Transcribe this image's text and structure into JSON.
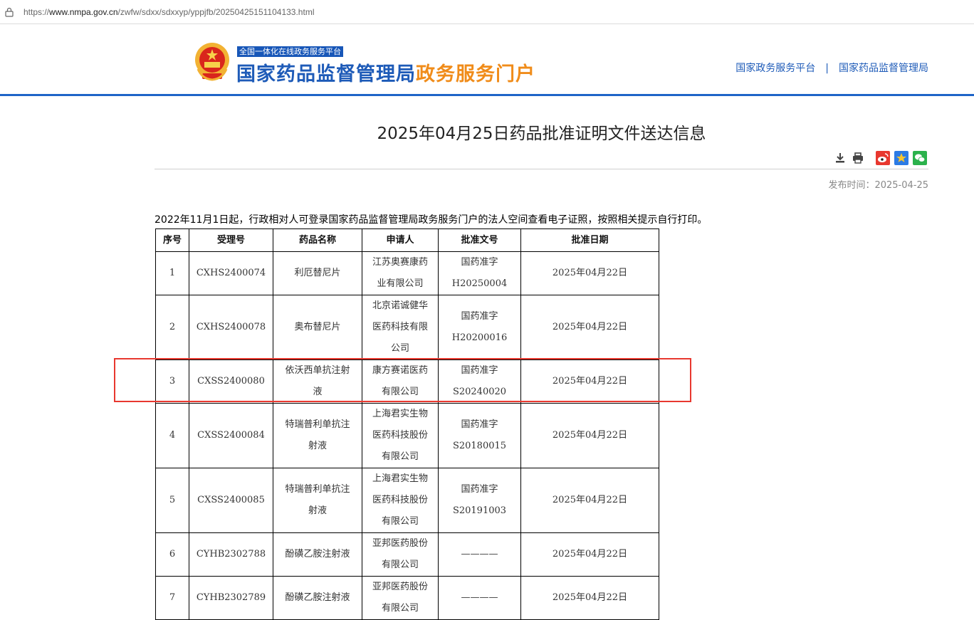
{
  "browser": {
    "url_scheme": "https://",
    "url_host": "www.nmpa.gov.cn",
    "url_path": "/zwfw/sdxx/sdxxyp/yppjfb/20250425151104133.html"
  },
  "header": {
    "platform_badge": "全国一体化在线政务服务平台",
    "title_main": "国家药品监督管理局",
    "title_sub": "政务服务门户",
    "links": [
      "国家政务服务平台",
      "国家药品监督管理局"
    ],
    "link_separator": "|"
  },
  "article": {
    "title": "2025年04月25日药品批准证明文件送达信息",
    "publish_time": "发布时间：2025-04-25",
    "notice": "2022年11月1日起，行政相对人可登录国家药品监督管理局政务服务门户的法人空间查看电子证照，按照相关提示自行打印。",
    "tools": [
      "download-icon",
      "print-icon",
      "weibo-icon",
      "qzone-icon",
      "wechat-icon"
    ]
  },
  "table": {
    "headers": [
      "序号",
      "受理号",
      "药品名称",
      "申请人",
      "批准文号",
      "批准日期"
    ],
    "rows": [
      {
        "no": "1",
        "accept": "CXHS2400074",
        "drug": [
          "利厄替尼片"
        ],
        "applicant": [
          "江苏奥赛康药",
          "业有限公司"
        ],
        "approval": [
          "国药准字",
          "H20250004"
        ],
        "date": "2025年04月22日"
      },
      {
        "no": "2",
        "accept": "CXHS2400078",
        "drug": [
          "奥布替尼片"
        ],
        "applicant": [
          "北京诺诚健华",
          "医药科技有限",
          "公司"
        ],
        "approval": [
          "国药准字",
          "H20200016"
        ],
        "date": "2025年04月22日"
      },
      {
        "no": "3",
        "accept": "CXSS2400080",
        "drug": [
          "依沃西单抗注射",
          "液"
        ],
        "applicant": [
          "康方赛诺医药",
          "有限公司"
        ],
        "approval": [
          "国药准字",
          "S20240020"
        ],
        "date": "2025年04月22日"
      },
      {
        "no": "4",
        "accept": "CXSS2400084",
        "drug": [
          "特瑞普利单抗注",
          "射液"
        ],
        "applicant": [
          "上海君实生物",
          "医药科技股份",
          "有限公司"
        ],
        "approval": [
          "国药准字",
          "S20180015"
        ],
        "date": "2025年04月22日"
      },
      {
        "no": "5",
        "accept": "CXSS2400085",
        "drug": [
          "特瑞普利单抗注",
          "射液"
        ],
        "applicant": [
          "上海君实生物",
          "医药科技股份",
          "有限公司"
        ],
        "approval": [
          "国药准字",
          "S20191003"
        ],
        "date": "2025年04月22日"
      },
      {
        "no": "6",
        "accept": "CYHB2302788",
        "drug": [
          "酚磺乙胺注射液"
        ],
        "applicant": [
          "亚邦医药股份",
          "有限公司"
        ],
        "approval": [
          "————"
        ],
        "date": "2025年04月22日"
      },
      {
        "no": "7",
        "accept": "CYHB2302789",
        "drug": [
          "酚磺乙胺注射液"
        ],
        "applicant": [
          "亚邦医药股份",
          "有限公司"
        ],
        "approval": [
          "————"
        ],
        "date": "2025年04月22日"
      }
    ]
  },
  "colors": {
    "brand_blue": "#1e5bb8",
    "brand_orange": "#f08c1a",
    "highlight_red": "#e8382f"
  }
}
